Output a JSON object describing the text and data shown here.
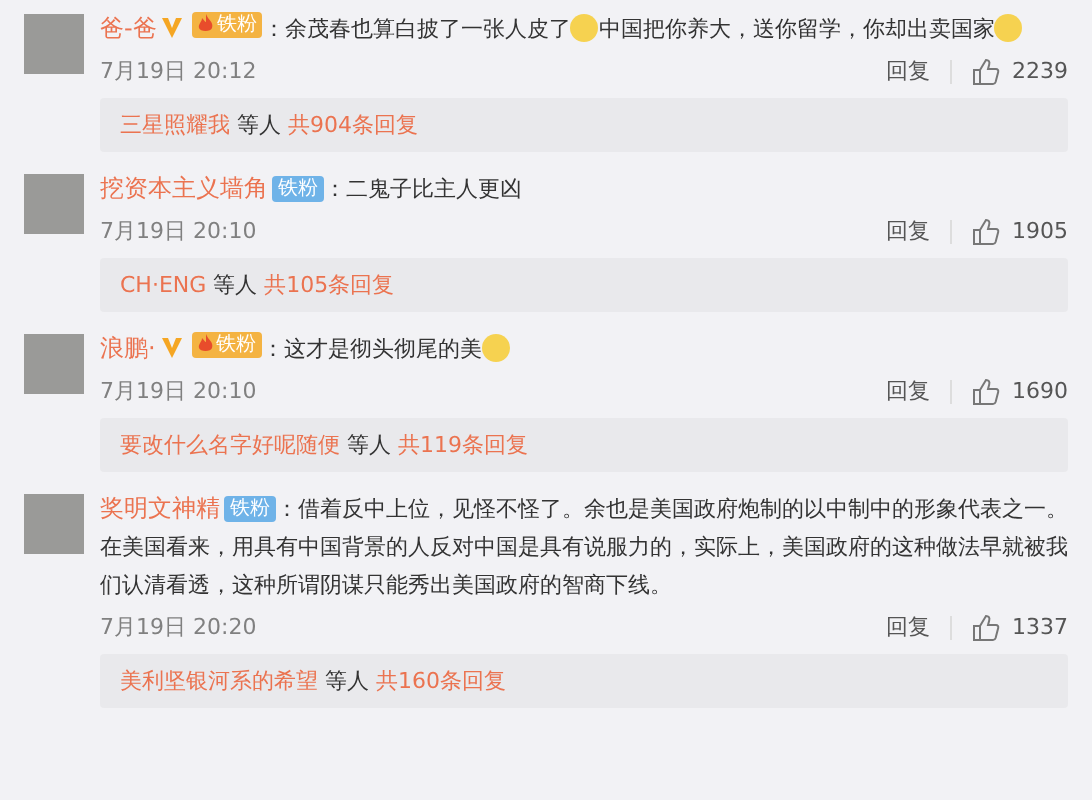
{
  "comments": [
    {
      "user": "爸-爸",
      "verified": true,
      "badge": {
        "kind": "fire",
        "label": "铁粉"
      },
      "segments": [
        {
          "kind": "text",
          "text": "：余茂春也算白披了一张人皮了"
        },
        {
          "kind": "emoji"
        },
        {
          "kind": "text",
          "text": "中国把你养大，送你留学，你却出卖国家"
        },
        {
          "kind": "emoji"
        }
      ],
      "time": "7月19日 20:12",
      "reply_label": "回复",
      "likes": "2239",
      "replies": {
        "user": "三星照耀我",
        "middle": "等人",
        "total": "共904条回复"
      }
    },
    {
      "user": "挖资本主义墙角",
      "verified": false,
      "badge": {
        "kind": "plain",
        "label": "铁粉"
      },
      "segments": [
        {
          "kind": "text",
          "text": "：二鬼子比主人更凶"
        }
      ],
      "time": "7月19日 20:10",
      "reply_label": "回复",
      "likes": "1905",
      "replies": {
        "user": "CH·ENG",
        "middle": "等人",
        "total": "共105条回复"
      }
    },
    {
      "user": "浪鹏·",
      "verified": true,
      "badge": {
        "kind": "fire",
        "label": "铁粉"
      },
      "segments": [
        {
          "kind": "text",
          "text": "：这才是彻头彻尾的美"
        },
        {
          "kind": "emoji"
        }
      ],
      "time": "7月19日 20:10",
      "reply_label": "回复",
      "likes": "1690",
      "replies": {
        "user": "要改什么名字好呢随便",
        "middle": "等人",
        "total": "共119条回复"
      }
    },
    {
      "user": "奖明文神精",
      "verified": false,
      "badge": {
        "kind": "plain",
        "label": "铁粉"
      },
      "segments": [
        {
          "kind": "text",
          "text": "：借着反中上位，见怪不怪了。余也是美国政府炮制的以中制中的形象代表之一。在美国看来，用具有中国背景的人反对中国是具有说服力的，实际上，美国政府的这种做法早就被我们认清看透，这种所谓阴谋只能秀出美国政府的智商下线。"
        }
      ],
      "time": "7月19日 20:20",
      "reply_label": "回复",
      "likes": "1337",
      "replies": {
        "user": "美利坚银河系的希望",
        "middle": "等人",
        "total": "共160条回复"
      }
    }
  ]
}
